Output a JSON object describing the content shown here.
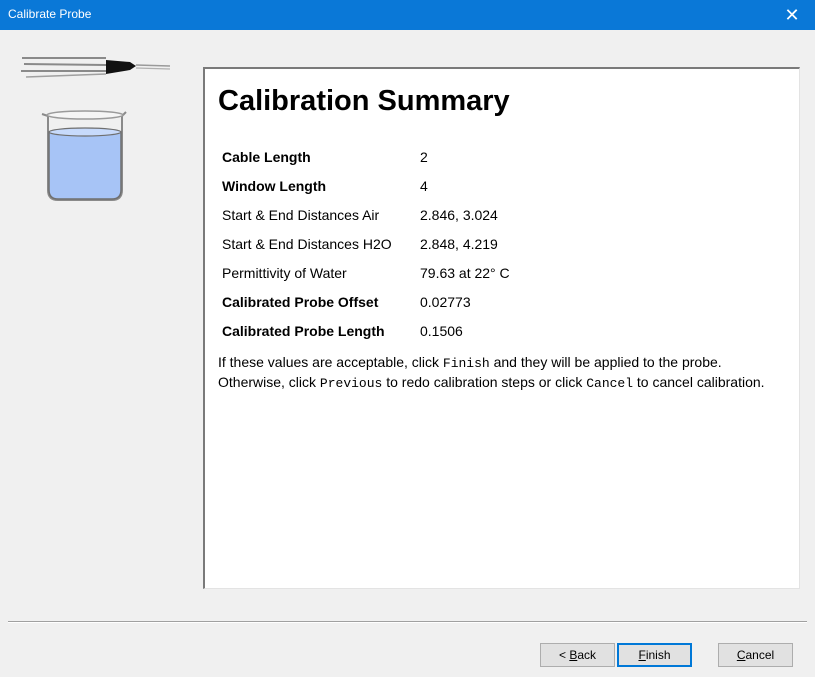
{
  "window": {
    "title": "Calibrate Probe",
    "close_glyph": "✕"
  },
  "illustration": {
    "probe_icon": "probe-icon",
    "beaker_icon": "beaker-icon",
    "water_color": "#a7c4f6"
  },
  "summary": {
    "heading": "Calibration Summary",
    "rows": [
      {
        "label": "Cable Length",
        "value": "2",
        "bold": true
      },
      {
        "label": "Window Length",
        "value": "4",
        "bold": true
      },
      {
        "label": "Start & End Distances Air",
        "value": "2.846, 3.024",
        "bold": false
      },
      {
        "label": "Start & End Distances H2O",
        "value": "2.848, 4.219",
        "bold": false
      },
      {
        "label": "Permittivity of Water",
        "value": "79.63 at 22° C",
        "bold": false
      },
      {
        "label": "Calibrated Probe Offset",
        "value": "0.02773",
        "bold": true
      },
      {
        "label": "Calibrated Probe Length",
        "value": "0.1506",
        "bold": true
      }
    ],
    "note": {
      "part1": "If these values are acceptable, click ",
      "finish_kw": "Finish",
      "part2": " and they will be applied to the probe. Otherwise, click ",
      "previous_kw": "Previous",
      "part3": " to redo calibration steps or click ",
      "cancel_kw": "Cancel",
      "part4": " to cancel calibration."
    }
  },
  "buttons": {
    "back": {
      "prefix": "< ",
      "mnemonic": "B",
      "rest": "ack"
    },
    "finish": {
      "prefix": "",
      "mnemonic": "F",
      "rest": "inish"
    },
    "cancel": {
      "prefix": "",
      "mnemonic": "C",
      "rest": "ancel"
    }
  },
  "colors": {
    "titlebar": "#0a78d7",
    "default_button_border": "#0078d7"
  }
}
